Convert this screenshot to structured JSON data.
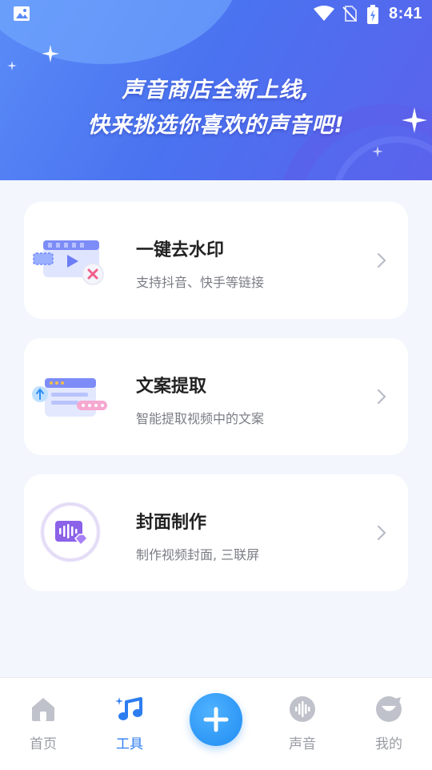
{
  "status_bar": {
    "time": "8:41"
  },
  "banner": {
    "line1": "声音商店全新上线,",
    "line2": "快来挑选你喜欢的声音吧!"
  },
  "tools": [
    {
      "title": "一键去水印",
      "description": "支持抖音、快手等链接",
      "icon": "video-watermark-icon"
    },
    {
      "title": "文案提取",
      "description": "智能提取视频中的文案",
      "icon": "text-extract-icon"
    },
    {
      "title": "封面制作",
      "description": "制作视频封面, 三联屏",
      "icon": "cover-make-icon"
    }
  ],
  "nav": {
    "home": "首页",
    "tools": "工具",
    "sound": "声音",
    "mine": "我的",
    "active": "tools",
    "accent": "#2d7df0"
  }
}
